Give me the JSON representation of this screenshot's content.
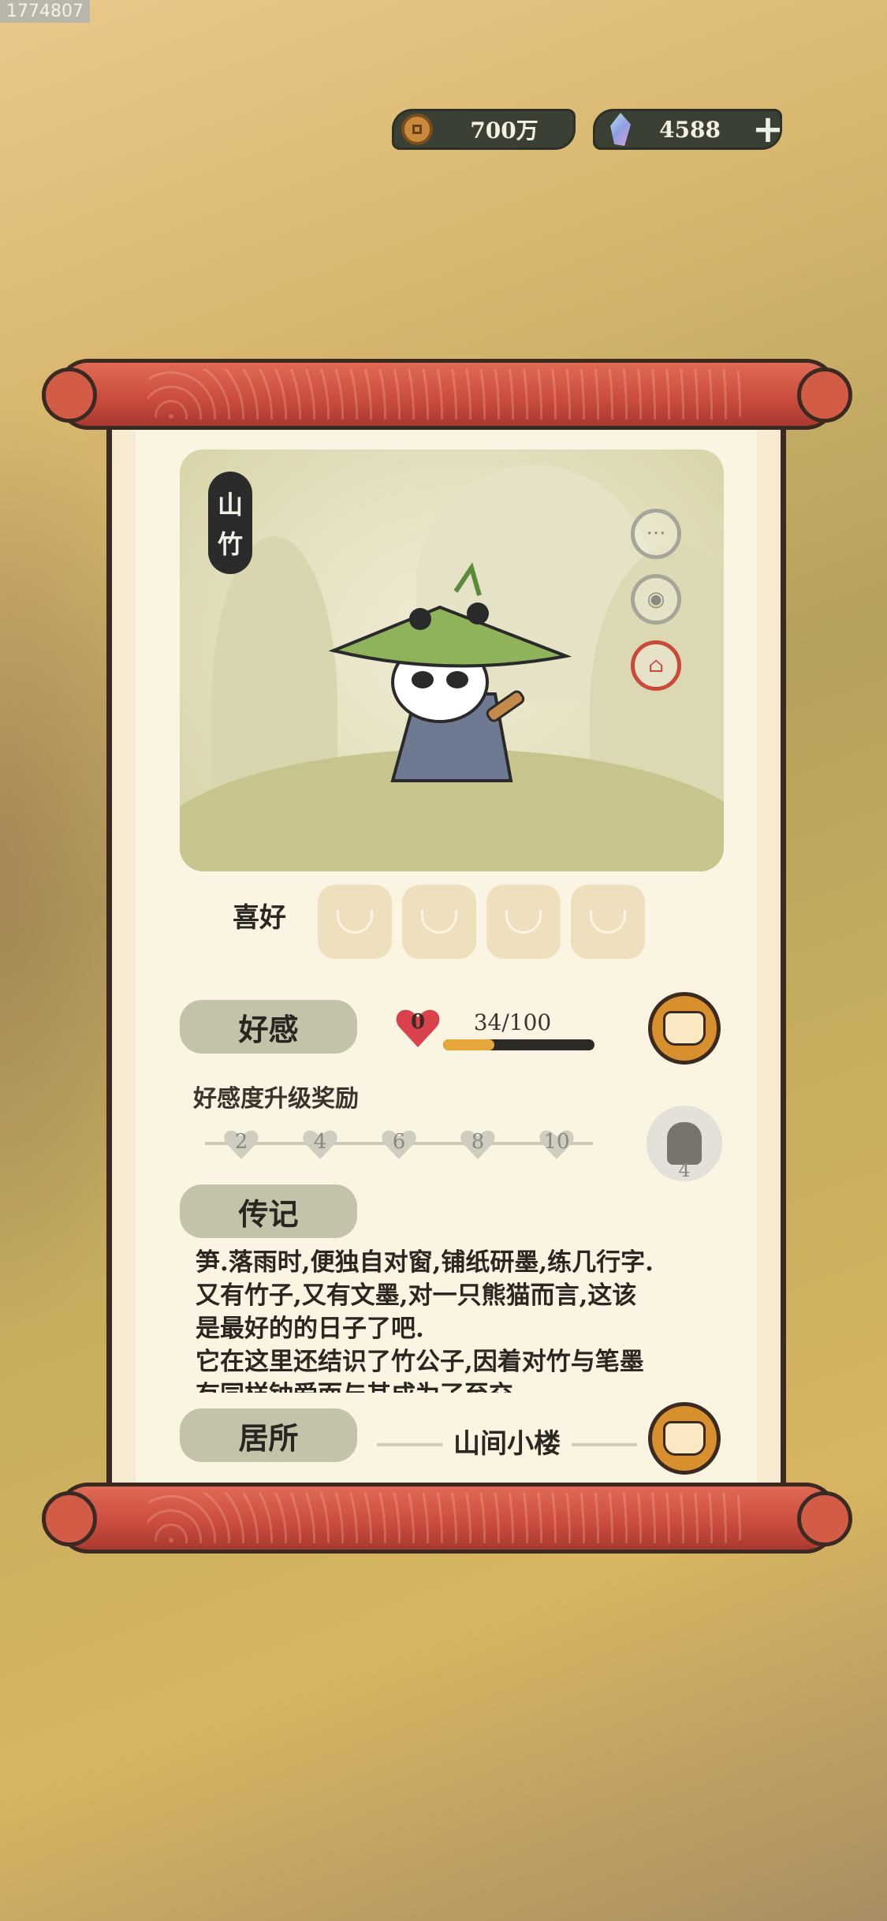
{
  "corner_id": "1774807",
  "currency": {
    "coins": "700万",
    "gems": "4588",
    "add_symbol": "+"
  },
  "character": {
    "name_chars": [
      "山",
      "竹"
    ],
    "side_buttons": [
      "chat-icon",
      "gift-drum-icon",
      "house-icon"
    ]
  },
  "hobby": {
    "label": "喜好",
    "slots": 4
  },
  "favor": {
    "label": "好感",
    "level": "0",
    "progress_text": "34/100",
    "progress": 0.34
  },
  "favor_reward": {
    "title": "好感度升级奖励",
    "levels": [
      "2",
      "4",
      "6",
      "8",
      "10"
    ],
    "reward_count": "4"
  },
  "biography": {
    "label": "传记",
    "lines": [
      "笋.落雨时,便独自对窗,铺纸研墨,练几行字.",
      "又有竹子,又有文墨,对一只熊猫而言,这该",
      "是最好的的日子了吧.",
      "它在这里还结识了竹公子,因着对竹与笔墨",
      "有同样钟爱而与其成为了至交"
    ]
  },
  "residence": {
    "label": "居所",
    "name": "山间小楼"
  },
  "colors": {
    "roll_red": "#c94b3f",
    "button_orange": "#d8902e",
    "heart_red": "#d9424d",
    "progress_orange": "#e6a63a"
  }
}
